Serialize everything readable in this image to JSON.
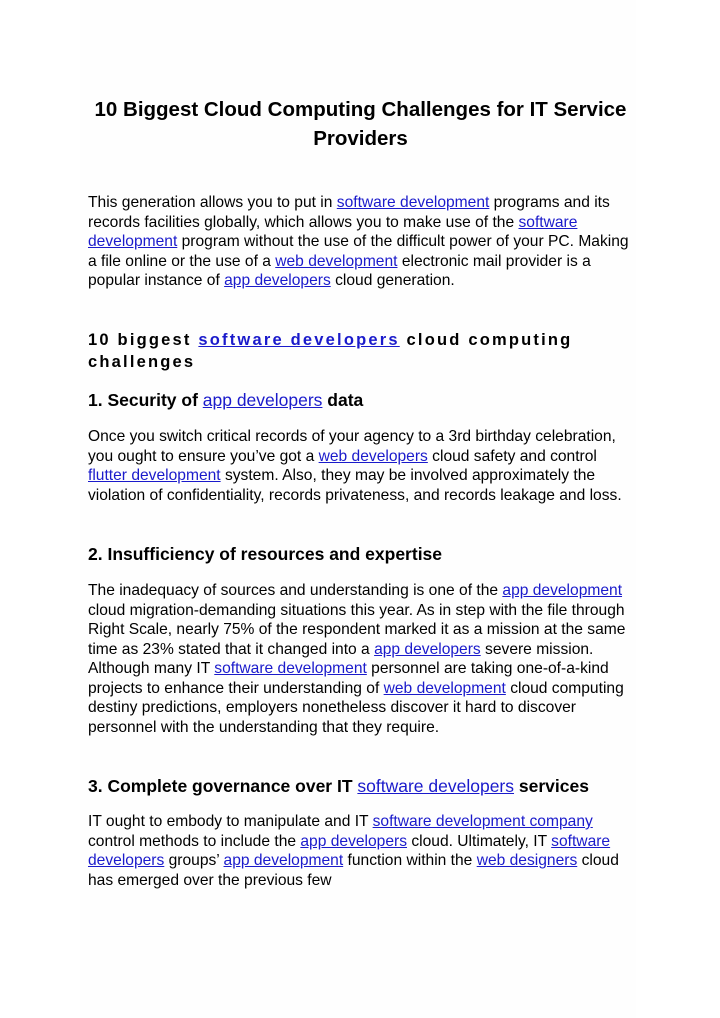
{
  "title": "10 Biggest Cloud Computing Challenges for IT Service Providers",
  "intro": {
    "parts": [
      {
        "t": "This generation allows you to put in "
      },
      {
        "l": "software development"
      },
      {
        "t": " programs and its records facilities globally, which allows you to make use of the "
      },
      {
        "l": "software development"
      },
      {
        "t": " program without the use of the difficult power of your PC. Making a file online or the use of a "
      },
      {
        "l": "web development"
      },
      {
        "t": " electronic mail provider is a popular instance of "
      },
      {
        "l": "app developers"
      },
      {
        "t": " cloud generation."
      }
    ]
  },
  "section_heading": {
    "prefix": "10 biggest ",
    "link": "software developers",
    "suffix": " cloud computing challenges"
  },
  "sections": [
    {
      "heading_prefix": "1. Security of ",
      "heading_link": "app developers",
      "heading_suffix": " data",
      "parts": [
        {
          "t": "Once you switch critical records of your agency to a 3rd birthday celebration, you ought to ensure you’ve got a "
        },
        {
          "l": "web developers"
        },
        {
          "t": " cloud safety and control "
        },
        {
          "l": "flutter development"
        },
        {
          "t": " system. Also, they may be involved approximately the violation of confidentiality, records privateness, and records leakage and loss."
        }
      ]
    },
    {
      "heading_prefix": "2. Insufficiency of resources and expertise",
      "heading_link": "",
      "heading_suffix": "",
      "parts": [
        {
          "t": "The inadequacy of sources and understanding is one of the "
        },
        {
          "l": "app development"
        },
        {
          "t": " cloud migration-demanding situations this year. As in step with the file through Right Scale, nearly 75% of the respondent marked it as a mission at the same time as 23% stated that it changed into a "
        },
        {
          "l": "app developers"
        },
        {
          "t": " severe mission. Although many IT "
        },
        {
          "l": "software development"
        },
        {
          "t": " personnel are taking one-of-a-kind projects to enhance their understanding of "
        },
        {
          "l": "web development"
        },
        {
          "t": " cloud computing destiny predictions, employers nonetheless discover it hard to discover personnel with the understanding that they require."
        }
      ]
    },
    {
      "heading_prefix": "3. Complete governance over IT ",
      "heading_link": "software developers",
      "heading_suffix": " services",
      "parts": [
        {
          "t": "IT ought to embody to manipulate and IT "
        },
        {
          "l": "software development company"
        },
        {
          "t": " control methods to include the "
        },
        {
          "l": "app developers"
        },
        {
          "t": " cloud. Ultimately, IT "
        },
        {
          "l": "software developers"
        },
        {
          "t": " groups’ "
        },
        {
          "l": "app development"
        },
        {
          "t": " function within the "
        },
        {
          "l": "web designers"
        },
        {
          "t": " cloud has emerged over the previous few"
        }
      ]
    }
  ],
  "colors": {
    "link": "#1a1acb",
    "text": "#000000",
    "background": "#ffffff"
  }
}
